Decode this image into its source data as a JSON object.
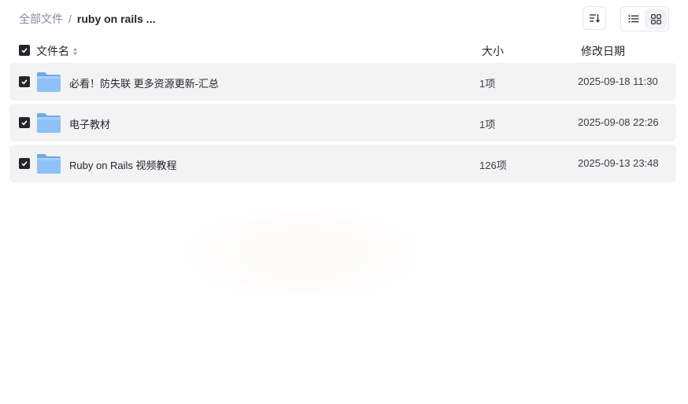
{
  "breadcrumb": {
    "root": "全部文件",
    "separator": "/",
    "current": "ruby on rails ..."
  },
  "toolbar": {
    "sort_icon": "sort-icon",
    "list_view_icon": "list-view-icon",
    "grid_view_icon": "grid-view-icon",
    "active_view": "list"
  },
  "table": {
    "headers": {
      "name": "文件名",
      "size": "大小",
      "modified": "修改日期"
    },
    "select_all_checked": true,
    "rows": [
      {
        "name": "必看！防失联 更多资源更新-汇总",
        "size": "1项",
        "modified": "2025-09-18 11:30",
        "checked": true,
        "icon": "folder-icon"
      },
      {
        "name": "电子教材",
        "size": "1项",
        "modified": "2025-09-08 22:26",
        "checked": true,
        "icon": "folder-icon"
      },
      {
        "name": "Ruby on Rails 视频教程",
        "size": "126项",
        "modified": "2025-09-13 23:48",
        "checked": true,
        "icon": "folder-icon"
      }
    ]
  },
  "colors": {
    "row_background": "#f3f3f4",
    "checkbox": "#25262b",
    "folder": "#8cc2f8"
  }
}
